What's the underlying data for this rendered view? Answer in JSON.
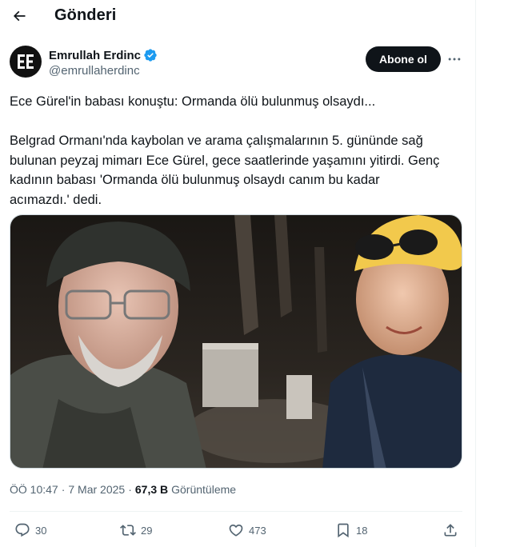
{
  "header": {
    "title": "Gönderi"
  },
  "author": {
    "name": "Emrullah Erdinc",
    "handle": "@emrullaherdinc",
    "avatar_text": "EE"
  },
  "subscribe_label": "Abone ol",
  "tweet": {
    "lines": [
      "Ece Gürel'in babası konuştu: Ormanda ölü bulunmuş olsaydı...",
      "",
      "Belgrad Ormanı'nda kaybolan ve arama çalışmalarının 5. gününde sağ",
      "bulunan peyzaj mimarı Ece Gürel, gece saatlerinde yaşamını yitirdi. Genç",
      "kadının babası 'Ormanda ölü bulunmuş olsaydı canım bu kadar",
      "acımazdı.' dedi."
    ]
  },
  "meta": {
    "time": "ÖÖ 10:47",
    "separator": "·",
    "date": "7 Mar 2025",
    "separator2": "·",
    "views_count": "67,3 B",
    "views_label": "Görüntüleme"
  },
  "actions": {
    "replies": "30",
    "reposts": "29",
    "likes": "473",
    "bookmarks": "18"
  },
  "colors": {
    "text": "#0f1419",
    "secondary": "#536471",
    "verified": "#1d9bf0",
    "button": "#0f1419"
  }
}
